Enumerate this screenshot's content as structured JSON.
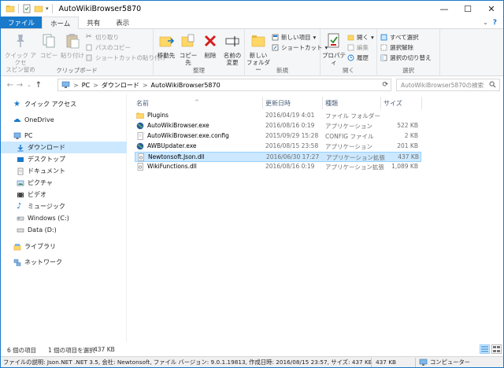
{
  "window": {
    "title": "AutoWikiBrowser5870",
    "minimize": "—",
    "maximize": "☐",
    "close": "✕"
  },
  "ribbon_tabs": {
    "file": "ファイル",
    "home": "ホーム",
    "share": "共有",
    "view": "表示",
    "help": "?"
  },
  "ribbon": {
    "clipboard": {
      "label": "クリップボード",
      "pin_line1": "クイック アクセ",
      "pin_line2": "スピン留め",
      "copy": "コピー",
      "paste": "貼り付け",
      "cut": "切り取り",
      "copy_path": "パスのコピー",
      "paste_shortcut": "ショートカットの貼り付け"
    },
    "organize": {
      "label": "整理",
      "move_to": "移動先",
      "copy_to": "コピー先",
      "delete": "削除",
      "rename_line1": "名前の",
      "rename_line2": "変更"
    },
    "new": {
      "label": "新規",
      "new_folder_line1": "新しい",
      "new_folder_line2": "フォルダー",
      "new_item": "新しい項目",
      "shortcut": "ショートカット"
    },
    "open": {
      "label": "開く",
      "properties": "プロパティ",
      "open": "開く",
      "edit": "編集",
      "history": "履歴"
    },
    "select": {
      "label": "選択",
      "select_all": "すべて選択",
      "select_none": "選択解除",
      "invert": "選択の切り替え"
    }
  },
  "address": {
    "path": [
      "PC",
      "ダウンロード",
      "AutoWikiBrowser5870"
    ],
    "separator": ">",
    "search_placeholder": "AutoWikiBrowser5870の検索"
  },
  "nav_pane": {
    "items": [
      {
        "label": "クイック アクセス",
        "icon": "star-icon"
      },
      {
        "label": "OneDrive",
        "icon": "cloud-icon"
      },
      {
        "label": "PC",
        "icon": "computer-icon"
      },
      {
        "label": "ダウンロード",
        "icon": "download-icon",
        "selected": true
      },
      {
        "label": "デスクトップ",
        "icon": "desktop-icon"
      },
      {
        "label": "ドキュメント",
        "icon": "documents-icon"
      },
      {
        "label": "ピクチャ",
        "icon": "pictures-icon"
      },
      {
        "label": "ビデオ",
        "icon": "video-icon"
      },
      {
        "label": "ミュージック",
        "icon": "music-icon"
      },
      {
        "label": "Windows (C:)",
        "icon": "drive-icon"
      },
      {
        "label": "Data (D:)",
        "icon": "drive-icon"
      },
      {
        "label": "ライブラリ",
        "icon": "library-icon"
      },
      {
        "label": "ネットワーク",
        "icon": "network-icon"
      }
    ]
  },
  "file_list": {
    "columns": {
      "name": "名前",
      "date": "更新日時",
      "type": "種類",
      "size": "サイズ"
    },
    "rows": [
      {
        "name": "Plugins",
        "date": "2016/04/19 4:01",
        "type": "ファイル フォルダー",
        "size": "",
        "icon": "folder-icon"
      },
      {
        "name": "AutoWikiBrowser.exe",
        "date": "2016/08/16 0:19",
        "type": "アプリケーション",
        "size": "522 KB",
        "icon": "globe-icon"
      },
      {
        "name": "AutoWikiBrowser.exe.config",
        "date": "2015/09/29 15:28",
        "type": "CONFIG ファイル",
        "size": "2 KB",
        "icon": "file-icon"
      },
      {
        "name": "AWBUpdater.exe",
        "date": "2016/08/15 23:58",
        "type": "アプリケーション",
        "size": "201 KB",
        "icon": "globe-icon"
      },
      {
        "name": "Newtonsoft.Json.dll",
        "date": "2016/06/30 17:27",
        "type": "アプリケーション拡張",
        "size": "437 KB",
        "icon": "dll-icon",
        "selected": true
      },
      {
        "name": "WikiFunctions.dll",
        "date": "2016/08/16 0:19",
        "type": "アプリケーション拡張",
        "size": "1,089 KB",
        "icon": "dll-icon"
      }
    ]
  },
  "status": {
    "item_count": "6 個の項目",
    "selection": "1 個の項目を選択",
    "selection_size": "437 KB"
  },
  "details": {
    "description": "ファイルの説明: Json.NET .NET 3.5, 会社: Newtonsoft, ファイル バージョン: 9.0.1.19813, 作成日時: 2016/08/15 23:57, サイズ: 437 KB",
    "size": "437 KB",
    "location": "コンピューター"
  },
  "colors": {
    "accent": "#1979ca",
    "selection": "#cce8ff",
    "folder": "#ffd766"
  }
}
